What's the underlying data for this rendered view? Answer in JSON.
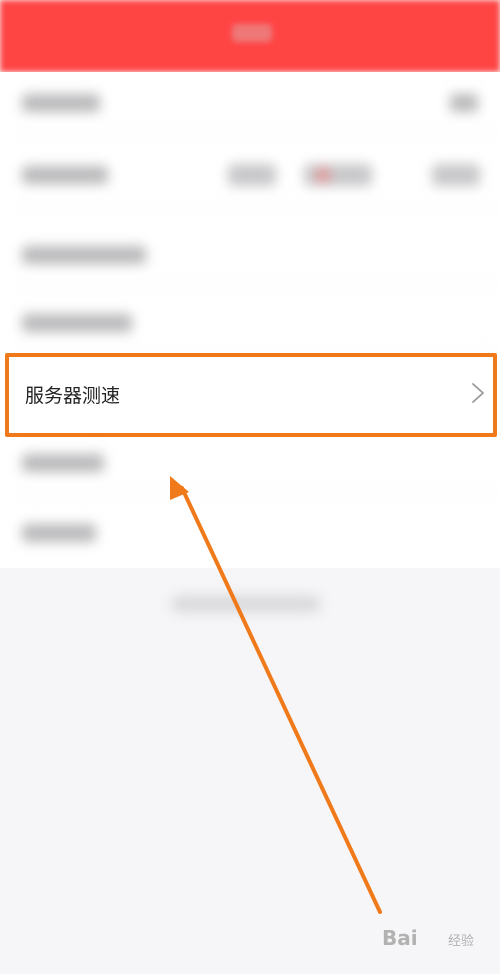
{
  "highlighted_row": {
    "label": "服务器测速",
    "chevron_icon": "chevron-right-icon"
  },
  "annotation": {
    "box_color": "#f07a1a",
    "arrow_color": "#f07a1a"
  },
  "watermark": {
    "text": "Bai",
    "suffix": "经验"
  },
  "colors": {
    "header": "#ff4444",
    "background": "#f6f5f7"
  }
}
